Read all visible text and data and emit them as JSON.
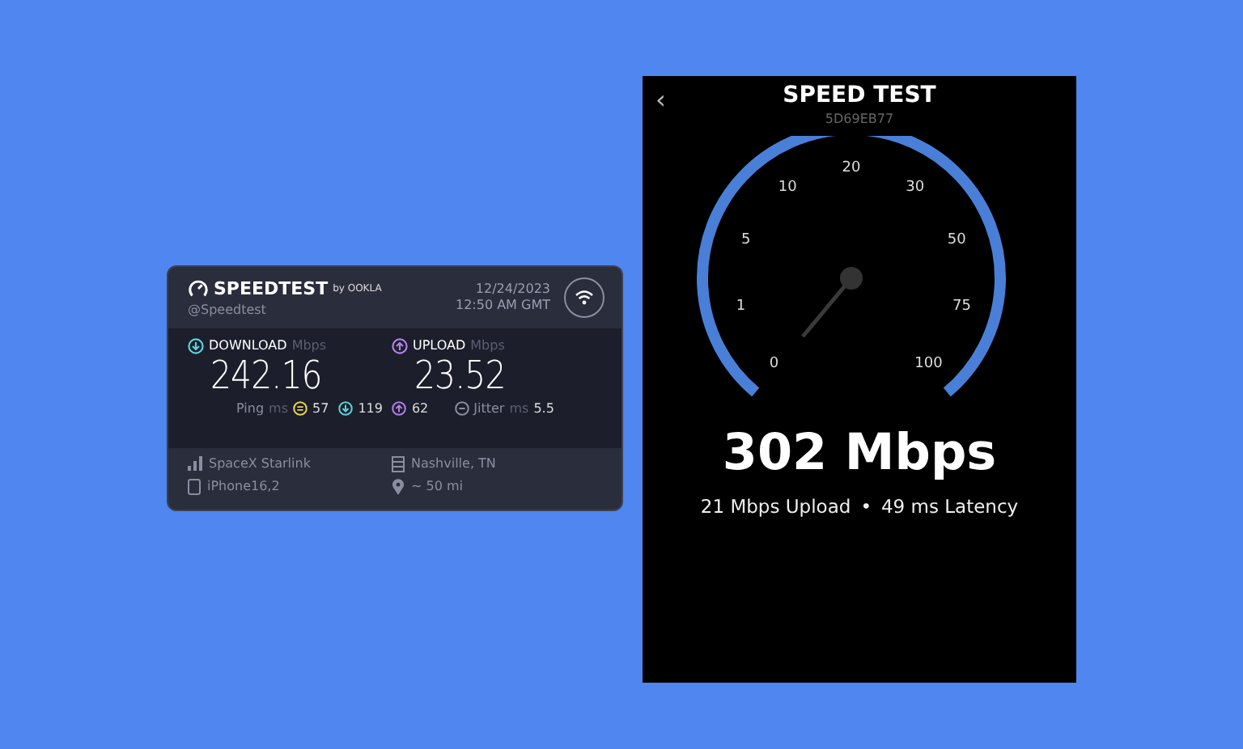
{
  "result_card": {
    "brand": "SPEEDTEST",
    "brand_suffix": "by OOKLA",
    "handle": "@Speedtest",
    "date": "12/24/2023",
    "time": "12:50 AM GMT",
    "download": {
      "label": "DOWNLOAD",
      "unit": "Mbps",
      "value": "242.16"
    },
    "upload": {
      "label": "UPLOAD",
      "unit": "Mbps",
      "value": "23.52"
    },
    "ping": {
      "label": "Ping",
      "unit": "ms",
      "idle": "57",
      "down": "119",
      "up": "62"
    },
    "jitter": {
      "label": "Jitter",
      "unit": "ms",
      "value": "5.5"
    },
    "provider": "SpaceX Starlink",
    "location": "Nashville, TN",
    "device": "iPhone16,2",
    "distance": "~ 50 mi"
  },
  "speed_test_screen": {
    "back": "‹",
    "title": "SPEED TEST",
    "code": "5D69EB77",
    "gauge_labels": [
      "0",
      "1",
      "5",
      "10",
      "20",
      "30",
      "50",
      "75",
      "100"
    ],
    "result": "302 Mbps",
    "upload": "21 Mbps Upload",
    "separator": "•",
    "latency": "49 ms Latency"
  }
}
